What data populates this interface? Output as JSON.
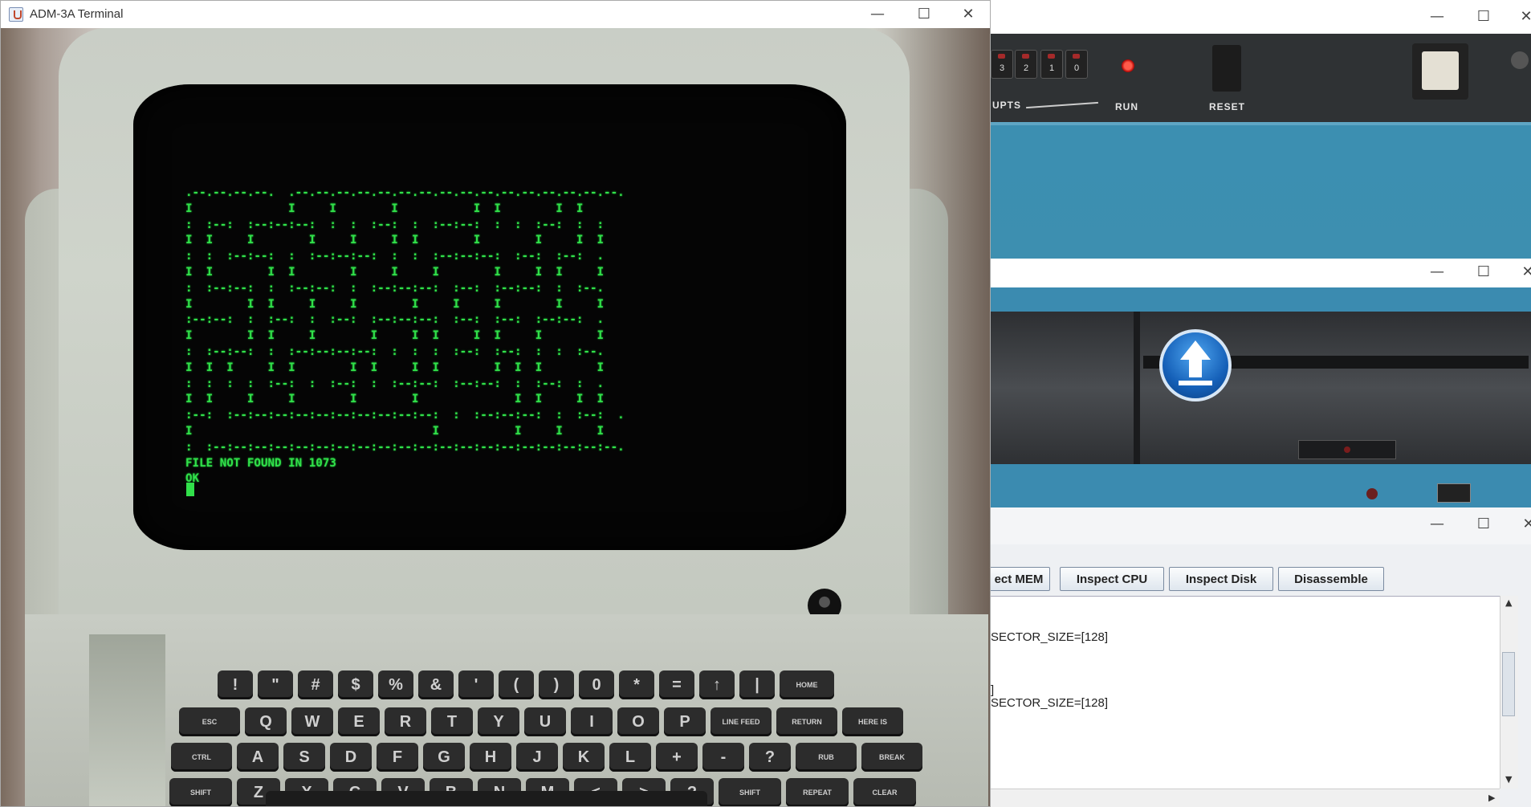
{
  "terminal": {
    "title": "ADM-3A Terminal",
    "screen_lines": [
      ".--.--.--.--.  .--.--.--.--.--.--.--.--.--.--.--.--.--.--.--.--.",
      "I              I     I        I           I  I        I  I",
      ":  :--:  :--:--:--:  :  :  :--:  :  :--:--:  :  :  :--:  :  :",
      "I  I     I        I     I     I  I        I        I     I  I",
      ":  :  :--:--:  :  :--:--:--:  :  :  :--:--:--:  :--:  :--:  .",
      "I  I        I  I        I     I     I        I     I  I     I",
      ":  :--:--:  :  :--:--:  :  :--:--:--:  :--:  :--:--:  :  :--.",
      "I        I  I     I     I        I     I     I        I     I",
      ":--:--:  :  :--:  :  :--:  :--:--:--:  :--:  :--:  :--:--:  .",
      "I        I  I     I        I     I  I     I  I     I        I",
      ":  :--:--:  :  :--:--:--:--:  :  :  :  :--:  :--:  :  :  :--.",
      "I  I  I     I  I        I  I     I  I        I  I  I        I",
      ":  :  :  :  :--:  :  :--:  :  :--:--:  :--:--:  :  :--:  :  .",
      "I  I     I     I        I        I              I  I     I  I",
      ":--:  :--:--:--:--:--:--:--:--:--:--:  :  :--:--:--:  :  :--:  .",
      "I                                   I           I     I     I",
      ":  :--:--:--:--:--:--:--:--:--:--:--:--:--:--:--:--:--:--:--:--.",
      "FILE NOT FOUND IN 1073",
      "OK"
    ],
    "keyboard": {
      "row1": [
        "!",
        "\"",
        "#",
        "$",
        "%",
        "&",
        "'",
        "(",
        ")",
        "0",
        "*",
        "=",
        "↑",
        "|",
        "HOME"
      ],
      "row2": [
        "ESC",
        "Q",
        "W",
        "E",
        "R",
        "T",
        "Y",
        "U",
        "I",
        "O",
        "P",
        "LINE FEED",
        "RETURN",
        "HERE IS"
      ],
      "row3": [
        "CTRL",
        "A",
        "S",
        "D",
        "F",
        "G",
        "H",
        "J",
        "K",
        "L",
        "+",
        "-",
        "?",
        "RUB",
        "BREAK"
      ],
      "row4": [
        "SHIFT",
        "Z",
        "X",
        "C",
        "V",
        "B",
        "N",
        "M",
        "<",
        ">",
        "?",
        "SHIFT",
        "REPEAT",
        "CLEAR"
      ]
    }
  },
  "front_panel": {
    "switch_labels": [
      "3",
      "2",
      "1",
      "0"
    ],
    "interrupts_label": "UPTS",
    "run_label": "RUN",
    "reset_label": "RESET"
  },
  "disk_window": {},
  "debug_window": {
    "buttons": [
      "ect MEM",
      "Inspect CPU",
      "Inspect Disk",
      "Disassemble"
    ],
    "lines": [
      "SECTOR_SIZE=[128]",
      "]",
      "SECTOR_SIZE=[128]"
    ]
  },
  "window_controls": {
    "minimize": "—",
    "maximize": "☐",
    "close": "✕"
  }
}
